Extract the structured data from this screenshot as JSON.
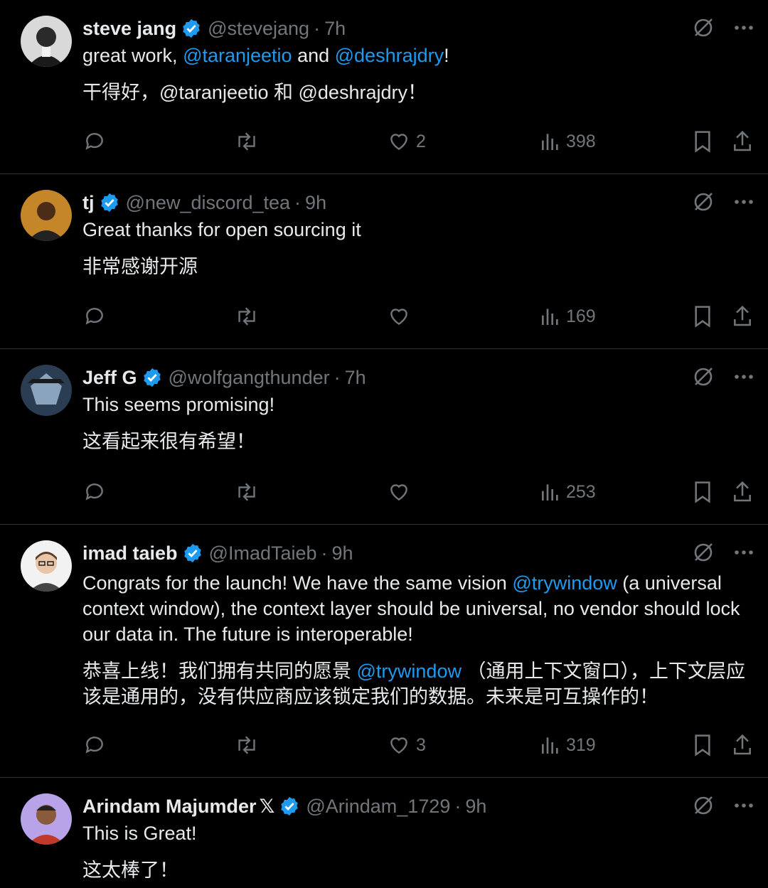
{
  "colors": {
    "background": "#000000",
    "text": "#e7e9ea",
    "muted": "#71767b",
    "accent": "#1d9bf0",
    "divider": "#2f3336"
  },
  "tweets": [
    {
      "name": "steve jang",
      "verified": true,
      "handle": "@stevejang",
      "time": "7h",
      "text": [
        "great work, ",
        "@taranjeetio",
        " and ",
        "@deshrajdry",
        "!"
      ],
      "translation": "干得好，@taranjeetio 和 @deshrajdry！",
      "likes": "2",
      "views": "398"
    },
    {
      "name": "tj",
      "verified": true,
      "handle": "@new_discord_tea",
      "time": "9h",
      "text": [
        "Great thanks for open sourcing it"
      ],
      "translation": "非常感谢开源",
      "likes": "",
      "views": "169"
    },
    {
      "name": "Jeff G",
      "verified": true,
      "handle": "@wolfgangthunder",
      "time": "7h",
      "text": [
        "This seems promising!"
      ],
      "translation": "这看起来很有希望！",
      "likes": "",
      "views": "253"
    },
    {
      "name": "imad taieb",
      "verified": true,
      "handle": "@ImadTaieb",
      "time": "9h",
      "text": [
        "Congrats for the launch! We have the same vision ",
        "@trywindow",
        " (a universal context window), the context layer should be universal, no vendor should lock our data in. The future is interoperable!"
      ],
      "translation_parts": [
        "恭喜上线！我们拥有共同的愿景 ",
        "@trywindow",
        " （通用上下文窗口），上下文层应该是通用的，没有供应商应该锁定我们的数据。未来是可互操作的！"
      ],
      "likes": "3",
      "views": "319"
    },
    {
      "name": "Arindam Majumder",
      "x_badge": "𝕏",
      "verified": true,
      "handle": "@Arindam_1729",
      "time": "9h",
      "text": [
        "This is Great!"
      ],
      "translation": "这太棒了！"
    }
  ],
  "icons": {
    "more": "more-icon",
    "grok": "grok-icon",
    "reply": "reply-icon",
    "retweet": "retweet-icon",
    "like": "heart-icon",
    "views": "views-icon",
    "bookmark": "bookmark-icon",
    "share": "share-icon",
    "verified": "verified-badge-icon"
  },
  "separator": "·"
}
